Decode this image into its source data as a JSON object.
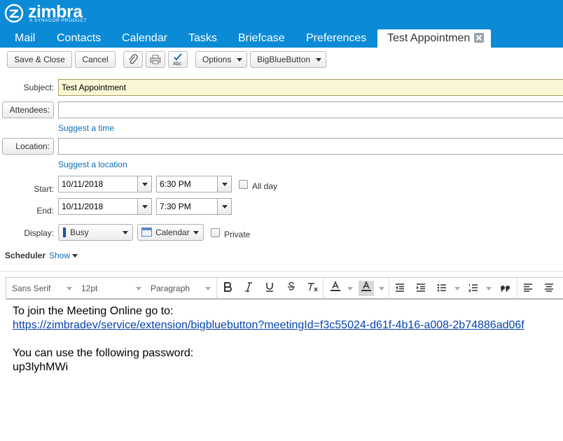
{
  "app": {
    "logo_text": "zimbra",
    "logo_subtext": "A SYNACOR PRODUCT"
  },
  "tabs": {
    "mail": "Mail",
    "contacts": "Contacts",
    "calendar": "Calendar",
    "tasks": "Tasks",
    "briefcase": "Briefcase",
    "preferences": "Preferences",
    "active": "Test Appointmen"
  },
  "toolbar": {
    "save_close": "Save & Close",
    "cancel": "Cancel",
    "options": "Options",
    "bigbluebutton": "BigBlueButton",
    "spellcheck_glyph": "Abc"
  },
  "form": {
    "subject_label": "Subject:",
    "subject_value": "Test Appointment",
    "attendees_label": "Attendees:",
    "attendees_value": "",
    "suggest_time": "Suggest a time",
    "location_label": "Location:",
    "location_value": "",
    "suggest_location": "Suggest a location",
    "start_label": "Start:",
    "start_date": "10/11/2018",
    "start_time": "6:30 PM",
    "all_day": "All day",
    "end_label": "End:",
    "end_date": "10/11/2018",
    "end_time": "7:30 PM",
    "display_label": "Display:",
    "display_value": "Busy",
    "calendar_value": "Calendar",
    "private": "Private",
    "scheduler_label": "Scheduler",
    "scheduler_show": "Show"
  },
  "editor": {
    "font_family": "Sans Serif",
    "font_size": "12pt",
    "block_format": "Paragraph"
  },
  "body": {
    "line1": "To join the Meeting Online go to:",
    "link": "https://zimbradev/service/extension/bigbluebutton?meetingId=f3c55024-d61f-4b16-a008-2b74886ad06f",
    "line3": "You can use the following password:",
    "password": "up3lyhMWi"
  },
  "colors": {
    "header_blue": "#0b8ad6",
    "subject_bg": "#f9f7d5",
    "link_blue": "#0b6fb4"
  }
}
